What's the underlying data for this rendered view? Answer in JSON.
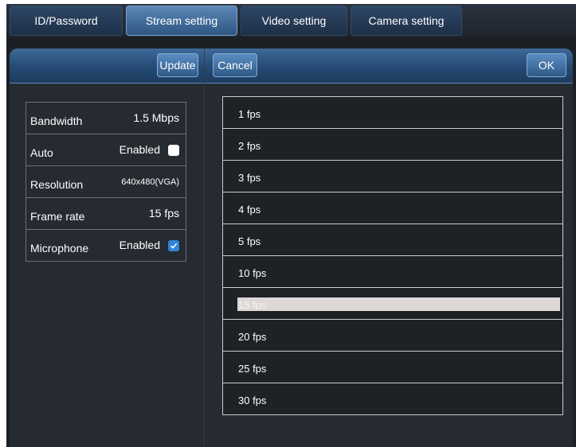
{
  "tabs": [
    {
      "label": "ID/Password",
      "active": false
    },
    {
      "label": "Stream setting",
      "active": true
    },
    {
      "label": "Video setting",
      "active": false
    },
    {
      "label": "Camera setting",
      "active": false
    }
  ],
  "left_header": {
    "update_label": "Update"
  },
  "right_header": {
    "cancel_label": "Cancel",
    "ok_label": "OK"
  },
  "settings": [
    {
      "label": "Bandwidth",
      "value": "1.5 Mbps"
    },
    {
      "label": "Auto",
      "value": "Enabled",
      "checked": false
    },
    {
      "label": "Resolution",
      "value": "640x480(VGA)"
    },
    {
      "label": "Frame rate",
      "value": "15 fps"
    },
    {
      "label": "Microphone",
      "value": "Enabled",
      "checked": true
    }
  ],
  "fps_options": [
    "1 fps",
    "2 fps",
    "3 fps",
    "4 fps",
    "5 fps",
    "10 fps",
    "15 fps",
    "20 fps",
    "25 fps",
    "30 fps"
  ],
  "selected_fps": "15 fps",
  "colors": {
    "accent": "#2e86d8",
    "tab_active": "#4f7aa8",
    "highlight": "#ddd8d6"
  }
}
